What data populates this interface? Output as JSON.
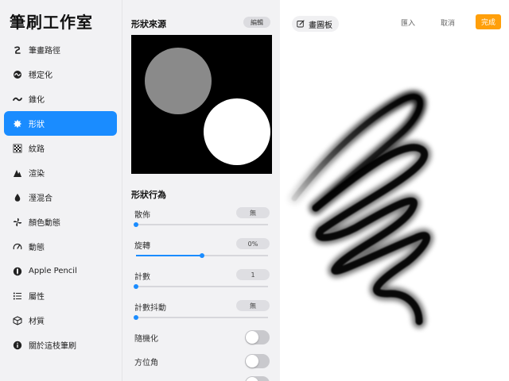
{
  "sidebar": {
    "title": "筆刷工作室",
    "items": [
      {
        "label": "筆畫路徑",
        "icon": "stroke-path-icon"
      },
      {
        "label": "穩定化",
        "icon": "stabilization-icon"
      },
      {
        "label": "錐化",
        "icon": "taper-icon"
      },
      {
        "label": "形狀",
        "icon": "shape-icon",
        "active": true
      },
      {
        "label": "紋路",
        "icon": "grain-icon"
      },
      {
        "label": "渲染",
        "icon": "rendering-icon"
      },
      {
        "label": "溼混合",
        "icon": "wet-mix-icon"
      },
      {
        "label": "顏色動態",
        "icon": "color-dynamics-icon"
      },
      {
        "label": "動態",
        "icon": "dynamics-icon"
      },
      {
        "label": "Apple Pencil",
        "icon": "apple-pencil-icon"
      },
      {
        "label": "屬性",
        "icon": "properties-icon"
      },
      {
        "label": "材質",
        "icon": "materials-icon"
      },
      {
        "label": "關於這枝筆刷",
        "icon": "about-icon"
      }
    ]
  },
  "panel": {
    "shape_source_title": "形狀來源",
    "edit_label": "編輯",
    "shape_behavior_title": "形狀行為",
    "sliders": [
      {
        "label": "散佈",
        "value": "無",
        "fraction": 0.0
      },
      {
        "label": "旋轉",
        "value": "0%",
        "fraction": 0.5
      },
      {
        "label": "計數",
        "value": "1",
        "fraction": 0.0
      },
      {
        "label": "計數抖動",
        "value": "無",
        "fraction": 0.0
      }
    ],
    "toggles": [
      {
        "label": "隨機化",
        "on": false
      },
      {
        "label": "方位角",
        "on": false
      }
    ]
  },
  "pad": {
    "label": "畫圖板",
    "import_label": "匯入",
    "cancel_label": "取消",
    "done_label": "完成"
  },
  "colors": {
    "accent": "#1a8cff",
    "done": "#ff9f0a"
  }
}
